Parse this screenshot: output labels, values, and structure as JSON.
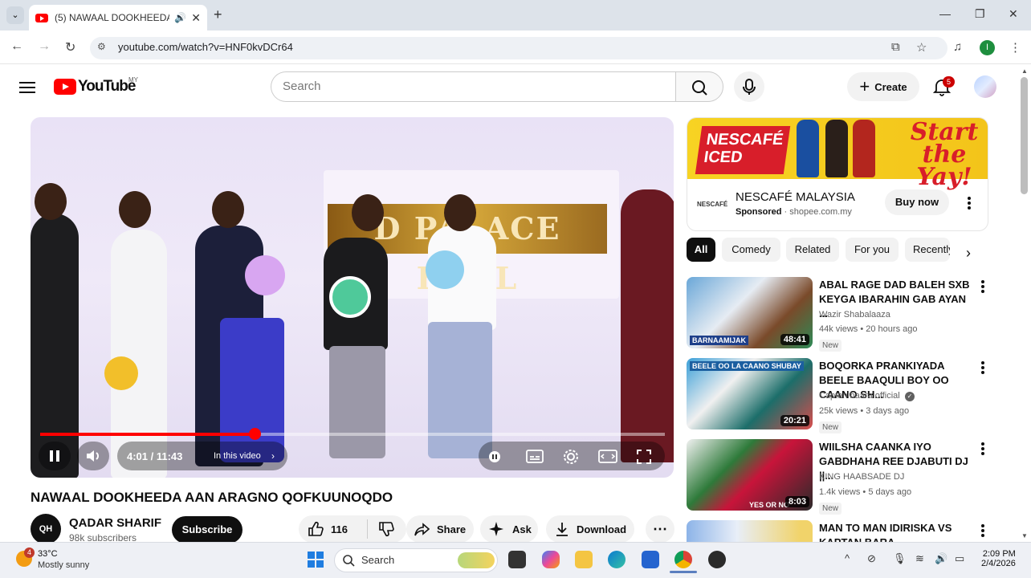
{
  "browser": {
    "tab_title": "(5) NAWAAL DOOKHEEDA /",
    "url": "youtube.com/watch?v=HNF0kvDCr64",
    "profile_initial": "I"
  },
  "header": {
    "logo_text": "YouTube",
    "country_code": "MY",
    "search_placeholder": "Search",
    "create_label": "Create",
    "notification_count": "5"
  },
  "player": {
    "time_display": "4:01 / 11:43",
    "chapter_label": "In this video",
    "progress": 0.343,
    "sign_text": "D PALACE HALL"
  },
  "video": {
    "title": "NAWAAL DOOKHEEDA AAN ARAGNO QOFKUUNOQDO",
    "channel_name": "QADAR SHARIF",
    "channel_avatar_text": "QH",
    "subscribers": "98k subscribers",
    "subscribe_label": "Subscribe",
    "like_count": "116",
    "share_label": "Share",
    "ask_label": "Ask",
    "download_label": "Download"
  },
  "ad": {
    "brand_art_text": "NESCAFÉ ICED",
    "slogan_line1": "Start",
    "slogan_line2": "the Yay!",
    "logo_text": "NESCAFÉ",
    "advertiser": "NESCAFÉ MALAYSIA",
    "sponsored_label": "Sponsored",
    "domain": "· shopee.com.my",
    "cta": "Buy now"
  },
  "chips": [
    "All",
    "Comedy",
    "Related",
    "For you",
    "Recently"
  ],
  "recommendations": [
    {
      "title": "ABAL RAGE DAD BALEH  SXB KEYGA IBARAHIN GAB AYAN ...",
      "channel": "Wazir Shabalaaza",
      "meta": "44k views • 20 hours ago",
      "badge": "New",
      "duration": "48:41",
      "thumb_text": "BARNAAMIJAK"
    },
    {
      "title": "BOQORKA PRANKIYADA BEELE BAAQULI BOY OO CAANO SH...",
      "channel": "Captan baara official",
      "meta": "25k views • 3 days ago",
      "badge": "New",
      "duration": "20:21",
      "thumb_text": "BEELE OO LA CAANO SHUBAY"
    },
    {
      "title": "WIILSHA CAANKA IYO GABDHAHA REE DJABUTI DJ ||...",
      "channel": "KING HAABSADE DJ",
      "meta": "1.4k views • 5 days ago",
      "badge": "New",
      "duration": "8:03",
      "thumb_text": "YES OR NO"
    },
    {
      "title": "MAN TO MAN IDIRISKA VS KAPTAN BARA",
      "channel": "",
      "meta": "",
      "badge": "",
      "duration": "",
      "thumb_text": ""
    }
  ],
  "taskbar": {
    "temperature": "33°C",
    "condition": "Mostly sunny",
    "weather_badge": "4",
    "search_label": "Search",
    "time": "2:09 PM",
    "date": "2/4/2026"
  }
}
